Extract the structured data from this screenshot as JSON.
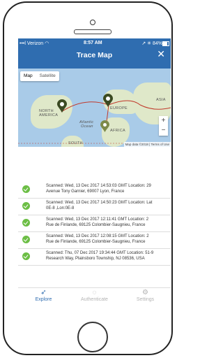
{
  "status": {
    "carrier": "•••l Verizon ◠",
    "time": "8:57 AM",
    "right": "↗ ✳ 84%"
  },
  "title": "Trace Map",
  "close_icon": "✕",
  "map": {
    "map_tab": "Map",
    "satellite_tab": "Satellite",
    "labels": [
      "NORTH",
      "AMERICA",
      "EUROPE",
      "ASIA",
      "AFRICA",
      "SOUTH",
      "Atlantic",
      "Ocean"
    ],
    "zoom_in": "+",
    "zoom_out": "−",
    "attribution": "Map data ©2018 | Terms of Use"
  },
  "scans": [
    {
      "line1": "Scanned: Wed, 13 Dec 2017 14:53:03 GMT  Location: 29",
      "line2": "Avenue Tony Garnier, 69007 Lyon, France"
    },
    {
      "line1": "Scanned: Wed, 13 Dec 2017 14:50:23 GMT  Location: Lat",
      "line2": "0E-8 ,Lon:0E-8"
    },
    {
      "line1": "Scanned: Wed, 13 Dec 2017 12:11:41 GMT  Location: 2",
      "line2": "Rue de Finlande, 69125 Colombier-Saugnieu, France"
    },
    {
      "line1": "Scanned: Wed, 13 Dec 2017 12:08:15 GMT  Location: 2",
      "line2": "Rue de Finlande, 69125 Colombier-Saugnieu, France"
    },
    {
      "line1": "Scanned: Thu, 07 Dec 2017 19:34:44 GMT  Location: 51-9",
      "line2": "Research Way, Plainsboro Township, NJ 08536, USA"
    }
  ],
  "tabs": [
    {
      "label": "Explore",
      "icon": "compass-icon",
      "glyph": "➶",
      "color": "#2f6db0"
    },
    {
      "label": "Authenticate",
      "icon": "fingerprint-icon",
      "glyph": "◌",
      "color": "#b3b3b3"
    },
    {
      "label": "Settings",
      "icon": "gear-icon",
      "glyph": "⚙",
      "color": "#b3b3b3"
    }
  ],
  "colors": {
    "header": "#2f6db0",
    "check": "#6cbe45",
    "pin": "#3b4a22"
  }
}
